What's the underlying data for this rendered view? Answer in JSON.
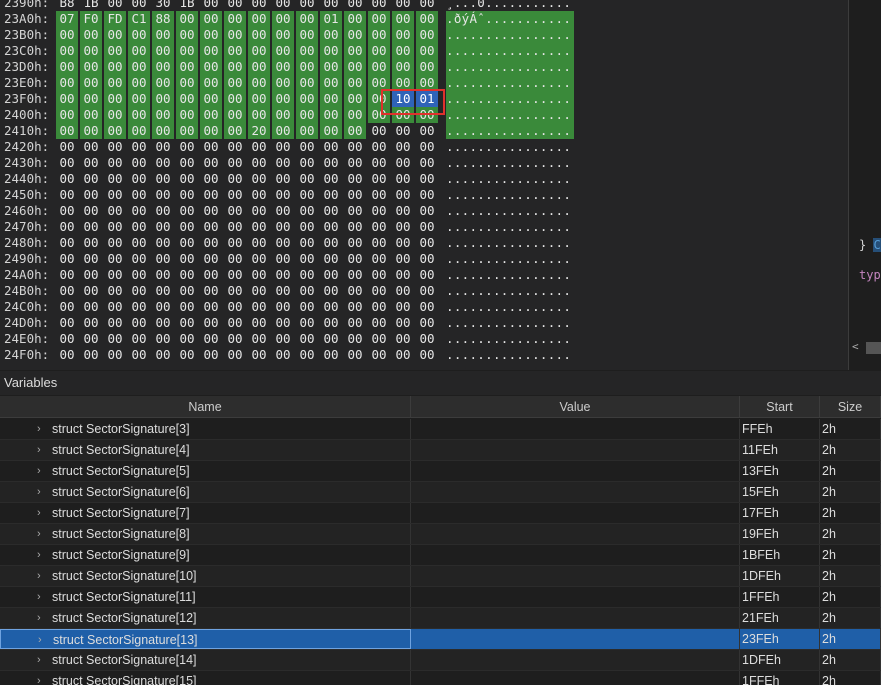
{
  "hex": {
    "rows": [
      {
        "offset": "2390h:",
        "bytes": [
          "B8",
          "1B",
          "00",
          "00",
          "30",
          "1B",
          "00",
          "00",
          "00",
          "00",
          "00",
          "00",
          "00",
          "00",
          "00",
          "00"
        ],
        "ascii": "¸...0...........",
        "green_from": -1,
        "green_to": -1
      },
      {
        "offset": "23A0h:",
        "bytes": [
          "07",
          "F0",
          "FD",
          "C1",
          "88",
          "00",
          "00",
          "00",
          "00",
          "00",
          "00",
          "01",
          "00",
          "00",
          "00",
          "00"
        ],
        "ascii": ".ðýÁˆ...........",
        "green_from": 0,
        "green_to": 15
      },
      {
        "offset": "23B0h:",
        "bytes": [
          "00",
          "00",
          "00",
          "00",
          "00",
          "00",
          "00",
          "00",
          "00",
          "00",
          "00",
          "00",
          "00",
          "00",
          "00",
          "00"
        ],
        "ascii": "................",
        "green_from": 0,
        "green_to": 15
      },
      {
        "offset": "23C0h:",
        "bytes": [
          "00",
          "00",
          "00",
          "00",
          "00",
          "00",
          "00",
          "00",
          "00",
          "00",
          "00",
          "00",
          "00",
          "00",
          "00",
          "00"
        ],
        "ascii": "................",
        "green_from": 0,
        "green_to": 15
      },
      {
        "offset": "23D0h:",
        "bytes": [
          "00",
          "00",
          "00",
          "00",
          "00",
          "00",
          "00",
          "00",
          "00",
          "00",
          "00",
          "00",
          "00",
          "00",
          "00",
          "00"
        ],
        "ascii": "................",
        "green_from": 0,
        "green_to": 15
      },
      {
        "offset": "23E0h:",
        "bytes": [
          "00",
          "00",
          "00",
          "00",
          "00",
          "00",
          "00",
          "00",
          "00",
          "00",
          "00",
          "00",
          "00",
          "00",
          "00",
          "00"
        ],
        "ascii": "................",
        "green_from": 0,
        "green_to": 15
      },
      {
        "offset": "23F0h:",
        "bytes": [
          "00",
          "00",
          "00",
          "00",
          "00",
          "00",
          "00",
          "00",
          "00",
          "00",
          "00",
          "00",
          "00",
          "00",
          "10",
          "01"
        ],
        "ascii": "................",
        "green_from": 0,
        "green_to": 13,
        "sel_from": 14,
        "sel_to": 15
      },
      {
        "offset": "2400h:",
        "bytes": [
          "00",
          "00",
          "00",
          "00",
          "00",
          "00",
          "00",
          "00",
          "00",
          "00",
          "00",
          "00",
          "00",
          "00",
          "00",
          "00"
        ],
        "ascii": "................",
        "green_from": 0,
        "green_to": 15
      },
      {
        "offset": "2410h:",
        "bytes": [
          "00",
          "00",
          "00",
          "00",
          "00",
          "00",
          "00",
          "00",
          "20",
          "00",
          "00",
          "00",
          "00",
          "00",
          "00",
          "00"
        ],
        "ascii": "................",
        "green_from": 0,
        "green_to": 12
      },
      {
        "offset": "2420h:",
        "bytes": [
          "00",
          "00",
          "00",
          "00",
          "00",
          "00",
          "00",
          "00",
          "00",
          "00",
          "00",
          "00",
          "00",
          "00",
          "00",
          "00"
        ],
        "ascii": "................",
        "green_from": -1,
        "green_to": -1
      },
      {
        "offset": "2430h:",
        "bytes": [
          "00",
          "00",
          "00",
          "00",
          "00",
          "00",
          "00",
          "00",
          "00",
          "00",
          "00",
          "00",
          "00",
          "00",
          "00",
          "00"
        ],
        "ascii": "................",
        "green_from": -1,
        "green_to": -1
      },
      {
        "offset": "2440h:",
        "bytes": [
          "00",
          "00",
          "00",
          "00",
          "00",
          "00",
          "00",
          "00",
          "00",
          "00",
          "00",
          "00",
          "00",
          "00",
          "00",
          "00"
        ],
        "ascii": "................",
        "green_from": -1,
        "green_to": -1
      },
      {
        "offset": "2450h:",
        "bytes": [
          "00",
          "00",
          "00",
          "00",
          "00",
          "00",
          "00",
          "00",
          "00",
          "00",
          "00",
          "00",
          "00",
          "00",
          "00",
          "00"
        ],
        "ascii": "................",
        "green_from": -1,
        "green_to": -1
      },
      {
        "offset": "2460h:",
        "bytes": [
          "00",
          "00",
          "00",
          "00",
          "00",
          "00",
          "00",
          "00",
          "00",
          "00",
          "00",
          "00",
          "00",
          "00",
          "00",
          "00"
        ],
        "ascii": "................",
        "green_from": -1,
        "green_to": -1
      },
      {
        "offset": "2470h:",
        "bytes": [
          "00",
          "00",
          "00",
          "00",
          "00",
          "00",
          "00",
          "00",
          "00",
          "00",
          "00",
          "00",
          "00",
          "00",
          "00",
          "00"
        ],
        "ascii": "................",
        "green_from": -1,
        "green_to": -1
      },
      {
        "offset": "2480h:",
        "bytes": [
          "00",
          "00",
          "00",
          "00",
          "00",
          "00",
          "00",
          "00",
          "00",
          "00",
          "00",
          "00",
          "00",
          "00",
          "00",
          "00"
        ],
        "ascii": "................",
        "green_from": -1,
        "green_to": -1
      },
      {
        "offset": "2490h:",
        "bytes": [
          "00",
          "00",
          "00",
          "00",
          "00",
          "00",
          "00",
          "00",
          "00",
          "00",
          "00",
          "00",
          "00",
          "00",
          "00",
          "00"
        ],
        "ascii": "................",
        "green_from": -1,
        "green_to": -1
      },
      {
        "offset": "24A0h:",
        "bytes": [
          "00",
          "00",
          "00",
          "00",
          "00",
          "00",
          "00",
          "00",
          "00",
          "00",
          "00",
          "00",
          "00",
          "00",
          "00",
          "00"
        ],
        "ascii": "................",
        "green_from": -1,
        "green_to": -1
      },
      {
        "offset": "24B0h:",
        "bytes": [
          "00",
          "00",
          "00",
          "00",
          "00",
          "00",
          "00",
          "00",
          "00",
          "00",
          "00",
          "00",
          "00",
          "00",
          "00",
          "00"
        ],
        "ascii": "................",
        "green_from": -1,
        "green_to": -1
      },
      {
        "offset": "24C0h:",
        "bytes": [
          "00",
          "00",
          "00",
          "00",
          "00",
          "00",
          "00",
          "00",
          "00",
          "00",
          "00",
          "00",
          "00",
          "00",
          "00",
          "00"
        ],
        "ascii": "................",
        "green_from": -1,
        "green_to": -1
      },
      {
        "offset": "24D0h:",
        "bytes": [
          "00",
          "00",
          "00",
          "00",
          "00",
          "00",
          "00",
          "00",
          "00",
          "00",
          "00",
          "00",
          "00",
          "00",
          "00",
          "00"
        ],
        "ascii": "................",
        "green_from": -1,
        "green_to": -1
      },
      {
        "offset": "24E0h:",
        "bytes": [
          "00",
          "00",
          "00",
          "00",
          "00",
          "00",
          "00",
          "00",
          "00",
          "00",
          "00",
          "00",
          "00",
          "00",
          "00",
          "00"
        ],
        "ascii": "................",
        "green_from": -1,
        "green_to": -1
      },
      {
        "offset": "24F0h:",
        "bytes": [
          "00",
          "00",
          "00",
          "00",
          "00",
          "00",
          "00",
          "00",
          "00",
          "00",
          "00",
          "00",
          "00",
          "00",
          "00",
          "00"
        ],
        "ascii": "................",
        "green_from": -1,
        "green_to": -1
      }
    ]
  },
  "right_pane": {
    "brace": "}",
    "brace_highlight": "C",
    "type_text": "typ"
  },
  "variables": {
    "title": "Variables",
    "columns": {
      "name": "Name",
      "value": "Value",
      "start": "Start",
      "size": "Size"
    },
    "rows": [
      {
        "name": "struct SectorSignature[3]",
        "value": "",
        "start": "FFEh",
        "size": "2h"
      },
      {
        "name": "struct SectorSignature[4]",
        "value": "",
        "start": "11FEh",
        "size": "2h"
      },
      {
        "name": "struct SectorSignature[5]",
        "value": "",
        "start": "13FEh",
        "size": "2h"
      },
      {
        "name": "struct SectorSignature[6]",
        "value": "",
        "start": "15FEh",
        "size": "2h"
      },
      {
        "name": "struct SectorSignature[7]",
        "value": "",
        "start": "17FEh",
        "size": "2h"
      },
      {
        "name": "struct SectorSignature[8]",
        "value": "",
        "start": "19FEh",
        "size": "2h"
      },
      {
        "name": "struct SectorSignature[9]",
        "value": "",
        "start": "1BFEh",
        "size": "2h"
      },
      {
        "name": "struct SectorSignature[10]",
        "value": "",
        "start": "1DFEh",
        "size": "2h"
      },
      {
        "name": "struct SectorSignature[11]",
        "value": "",
        "start": "1FFEh",
        "size": "2h"
      },
      {
        "name": "struct SectorSignature[12]",
        "value": "",
        "start": "21FEh",
        "size": "2h"
      },
      {
        "name": "struct SectorSignature[13]",
        "value": "",
        "start": "23FEh",
        "size": "2h",
        "selected": true
      },
      {
        "name": "struct SectorSignature[14]",
        "value": "",
        "start": "1DFEh",
        "size": "2h"
      },
      {
        "name": "struct SectorSignature[15]",
        "value": "",
        "start": "1FFEh",
        "size": "2h"
      }
    ]
  },
  "colors": {
    "highlight_green": "#3a8a3a",
    "selection_blue": "#1f5fa8",
    "annotation_red": "#e0312c"
  }
}
